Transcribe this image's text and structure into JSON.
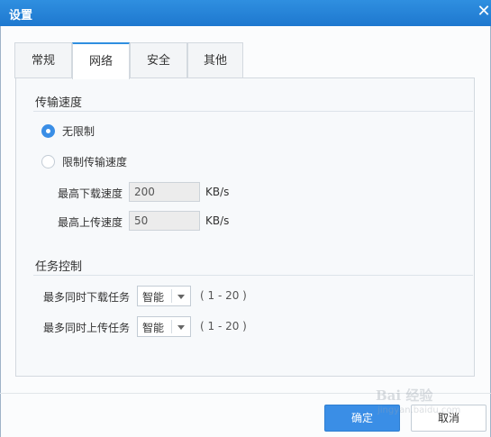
{
  "window": {
    "title": "设置",
    "close_glyph": "✕"
  },
  "tabs": [
    {
      "label": "常规",
      "active": false
    },
    {
      "label": "网络",
      "active": true
    },
    {
      "label": "安全",
      "active": false
    },
    {
      "label": "其他",
      "active": false
    }
  ],
  "speed": {
    "section_title": "传输速度",
    "options": [
      {
        "label": "无限制",
        "selected": true
      },
      {
        "label": "限制传输速度",
        "selected": false
      }
    ],
    "download_label": "最高下载速度",
    "download_value": "200",
    "upload_label": "最高上传速度",
    "upload_value": "50",
    "unit": "KB/s"
  },
  "tasks": {
    "section_title": "任务控制",
    "download_label": "最多同时下载任务",
    "download_value": "智能",
    "upload_label": "最多同时上传任务",
    "upload_value": "智能",
    "range_text": "( 1 - 20 )"
  },
  "footer": {
    "ok_label": "确定",
    "cancel_label": "取消"
  },
  "watermark": {
    "line1": "Bai 经验",
    "line2": "jingyan.baidu.com"
  },
  "colors": {
    "accent": "#3a8ee6",
    "titlebar": "#2f8fe0"
  }
}
